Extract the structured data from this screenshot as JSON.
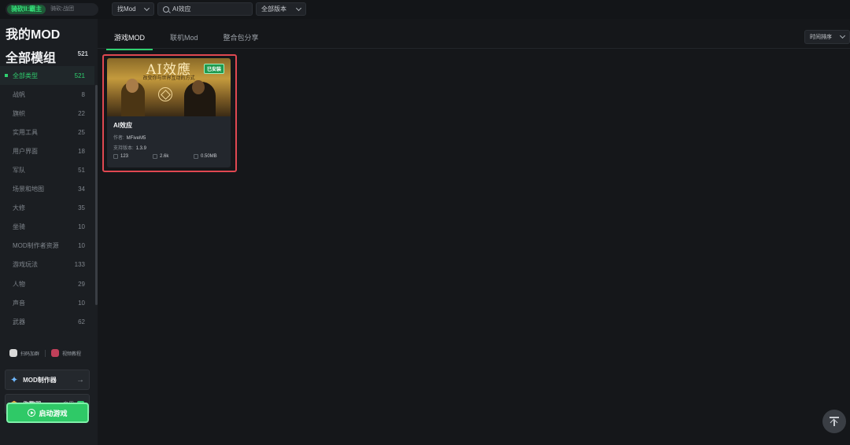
{
  "topbar": {
    "game_tabs": [
      {
        "label": "骑砍II:霸主",
        "active": true
      },
      {
        "label": "骑砍:战团",
        "active": false
      }
    ],
    "type_filter": "找Mod",
    "search_value": "AI效应",
    "version_filter": "全部版本"
  },
  "sidebar": {
    "title": "我的MOD",
    "all_mods_label": "全部模组",
    "all_mods_count": "521",
    "categories": [
      {
        "label": "全部类型",
        "count": "521",
        "active": true
      },
      {
        "label": "战帆",
        "count": "8"
      },
      {
        "label": "旗帜",
        "count": "22"
      },
      {
        "label": "实用工具",
        "count": "25"
      },
      {
        "label": "用户界面",
        "count": "18"
      },
      {
        "label": "军队",
        "count": "51"
      },
      {
        "label": "场景和地图",
        "count": "34"
      },
      {
        "label": "大修",
        "count": "35"
      },
      {
        "label": "坐骑",
        "count": "10"
      },
      {
        "label": "MOD制作者资源",
        "count": "10"
      },
      {
        "label": "游戏玩法",
        "count": "133"
      },
      {
        "label": "人物",
        "count": "29"
      },
      {
        "label": "声音",
        "count": "10"
      },
      {
        "label": "武器",
        "count": "62"
      }
    ],
    "links": [
      "扫码加群",
      "视频教程"
    ],
    "mod_maker_label": "MOD制作器",
    "cheat_label": "作弊器",
    "cheat_enable_label": "启用",
    "launch_label": "启动游戏"
  },
  "main": {
    "tabs": [
      "游戏MOD",
      "联机Mod",
      "整合包分享"
    ],
    "sort_label": "时间排序",
    "card": {
      "image_title": "AI效應",
      "image_subtitle": "改变你与世界互动的方式",
      "installed_badge": "已安装",
      "name": "AI效应",
      "author_label": "作者:",
      "author": "MFiveM5",
      "version_label": "支持版本:",
      "version": "1.3.9",
      "likes": "123",
      "downloads": "2.6k",
      "size": "0.50MB"
    }
  },
  "colors": {
    "accent": "#2fd06f",
    "highlight": "#e04851",
    "background": "#15171a"
  }
}
